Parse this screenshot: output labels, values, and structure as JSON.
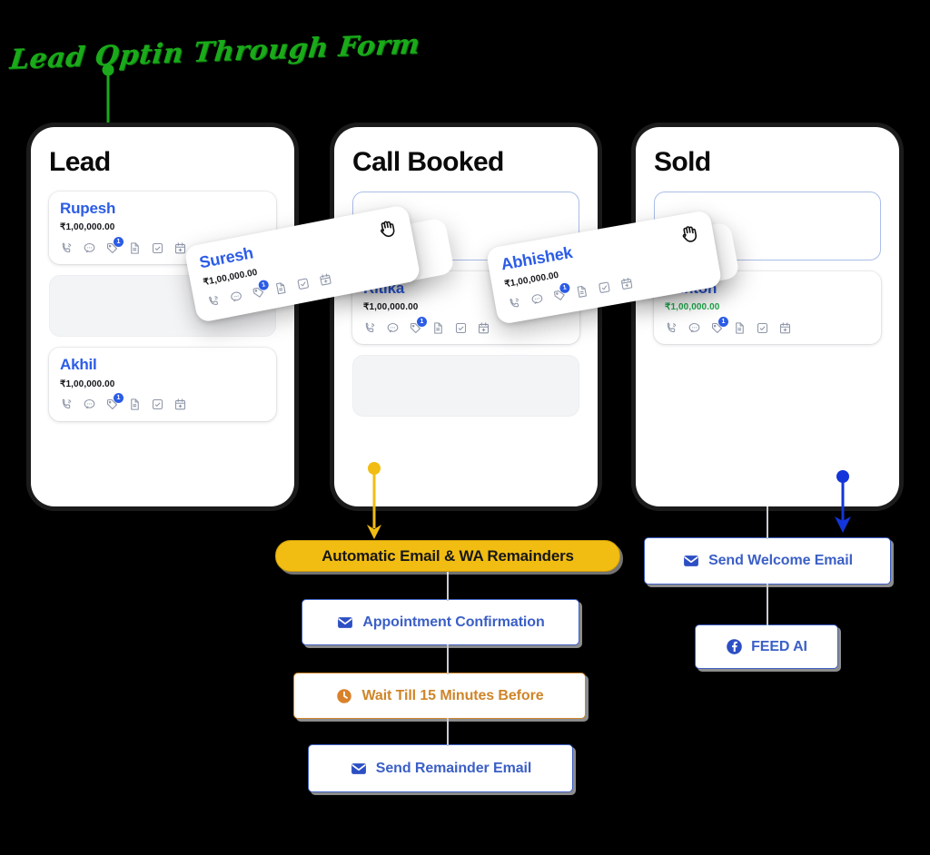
{
  "title": {
    "text": "Lead Optin Through Form",
    "color": "#1aaa1a"
  },
  "colors": {
    "name_blue": "#2b5ce6",
    "amount_green": "#1faa4b",
    "node_blue": "#3b5fc6",
    "node_orange": "#cf8529",
    "pill_yellow": "#f2bd12",
    "connector_grey": "#c9ccd1",
    "background": "#000000"
  },
  "board": {
    "columns": [
      {
        "name": "lead",
        "title": "Lead",
        "cards": [
          {
            "name": "Rupesh",
            "amount": "₹1,00,000.00",
            "amount_color": "black",
            "icons": [
              "phone-icon",
              "chat-icon",
              "tag-icon",
              "document-icon",
              "checkbox-icon",
              "calendar-plus-icon"
            ],
            "badge": "1"
          },
          {
            "placeholder": true
          },
          {
            "name": "Akhil",
            "amount": "₹1,00,000.00",
            "amount_color": "black",
            "icons": [
              "phone-icon",
              "chat-icon",
              "tag-icon",
              "document-icon",
              "checkbox-icon",
              "calendar-plus-icon"
            ],
            "badge": "1"
          }
        ]
      },
      {
        "name": "call-booked",
        "title": "Call Booked",
        "cards": [
          {
            "dropzone": true
          },
          {
            "name": "Ritika",
            "amount": "₹1,00,000.00",
            "amount_color": "black",
            "icons": [
              "phone-icon",
              "chat-icon",
              "tag-icon",
              "document-icon",
              "checkbox-icon",
              "calendar-plus-icon"
            ],
            "badge": "1"
          },
          {
            "placeholder": true
          }
        ]
      },
      {
        "name": "sold",
        "title": "Sold",
        "cards": [
          {
            "dropzone": true
          },
          {
            "name": "Clinton",
            "amount": "₹1,00,000.00",
            "amount_color": "green",
            "icons": [
              "phone-icon",
              "chat-icon",
              "tag-icon",
              "document-icon",
              "checkbox-icon",
              "calendar-plus-icon"
            ],
            "badge": "1"
          }
        ]
      }
    ]
  },
  "dragged_cards": [
    {
      "name": "Suresh",
      "amount": "₹1,00,000.00",
      "badge": "1",
      "cursor": "grab-hand-icon",
      "rotation_deg": -11
    },
    {
      "name": "Abhishek",
      "amount": "₹1,00,000.00",
      "badge": "1",
      "cursor": "grab-hand-icon",
      "rotation_deg": -10
    }
  ],
  "automation": {
    "pill": {
      "label": "Automatic Email & WA Remainders",
      "color": "#f2bd12"
    },
    "nodes": [
      {
        "key": "appointment_confirmation",
        "label": "Appointment Confirmation",
        "icon": "envelope-icon",
        "style": "blue"
      },
      {
        "key": "wait_15_minutes",
        "label": "Wait Till 15 Minutes Before",
        "icon": "clock-icon",
        "style": "orange"
      },
      {
        "key": "send_remainder_email",
        "label": "Send Remainder Email",
        "icon": "envelope-icon",
        "style": "blue"
      },
      {
        "key": "send_welcome_email",
        "label": "Send Welcome Email",
        "icon": "envelope-icon",
        "style": "blue"
      },
      {
        "key": "feed_ai",
        "label": "FEED AI",
        "icon": "facebook-icon",
        "style": "blue"
      }
    ]
  }
}
